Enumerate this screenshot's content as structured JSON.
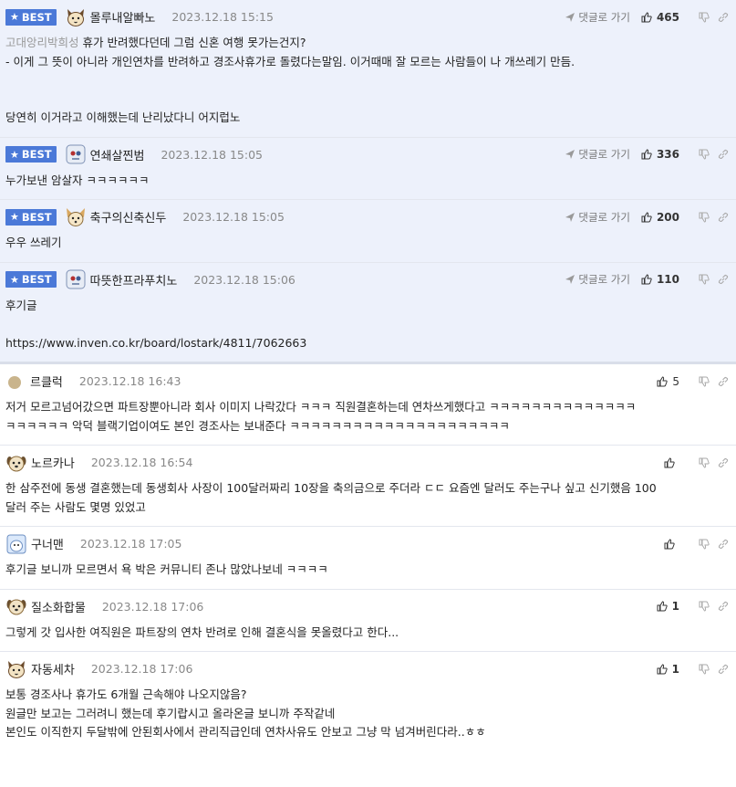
{
  "best_label": "BEST",
  "reply_label": "댓글로 가기",
  "best_comments": [
    {
      "nick": "몰루내알빠노",
      "avatar": "cat-face-icon",
      "date": "2023.12.18 15:15",
      "likes": "465",
      "target": "고대앙리박희성",
      "first_line": " 휴가 반려했다던데 그럼 신혼 여행 못가는건지?",
      "text": "- 이게 그 뜻이 아니라 개인연차를 반려하고 경조사휴가로 돌렸다는말임. 이거때매 잘 모르는 사람들이 나 개쓰레기 만듬.\n\n\n당연히 이거라고 이해했는데 난리났다니 어지럽노"
    },
    {
      "nick": "연쇄살찐범",
      "avatar": "robot-face-icon",
      "date": "2023.12.18 15:05",
      "likes": "336",
      "target": "",
      "first_line": "",
      "text": "누가보낸 암살자 ㅋㅋㅋㅋㅋㅋ"
    },
    {
      "nick": "축구의신축신두",
      "avatar": "fox-face-icon",
      "date": "2023.12.18 15:05",
      "likes": "200",
      "target": "",
      "first_line": "",
      "text": "우우 쓰레기"
    },
    {
      "nick": "따뜻한프라푸치노",
      "avatar": "robot-face-icon",
      "date": "2023.12.18 15:06",
      "likes": "110",
      "target": "",
      "first_line": "",
      "text": "후기글\n\nhttps://www.inven.co.kr/board/lostark/4811/7062663"
    }
  ],
  "comments": [
    {
      "nick": "르클럭",
      "avatar": "dot-avatar-icon",
      "date": "2023.12.18 16:43",
      "likes": "5",
      "text": "저거 모르고넘어갔으면 파트장뿐아니라 회사 이미지 나락갔다 ㅋㅋㅋ 직원결혼하는데 연차쓰게했다고 ㅋㅋㅋㅋㅋㅋㅋㅋㅋㅋㅋㅋㅋㅋ\nㅋㅋㅋㅋㅋㅋ 악덕 블랙기업이여도 본인 경조사는 보내준다 ㅋㅋㅋㅋㅋㅋㅋㅋㅋㅋㅋㅋㅋㅋㅋㅋㅋㅋㅋㅋㅋ"
    },
    {
      "nick": "노르카나",
      "avatar": "dog-face-icon",
      "date": "2023.12.18 16:54",
      "likes": "",
      "text": "한 삼주전에 동생 결혼했는데 동생회사 사장이 100달러짜리 10장을 축의금으로 주더라 ㄷㄷ 요즘엔 달러도 주는구나 싶고 신기했음 100\n달러 주는 사람도 몇명 있었고"
    },
    {
      "nick": "구너맨",
      "avatar": "bear-face-icon",
      "date": "2023.12.18 17:05",
      "likes": "",
      "text": "후기글 보니까 모르면서 욕 박은 커뮤니티 존나 많았나보네 ㅋㅋㅋㅋ"
    },
    {
      "nick": "질소화합물",
      "avatar": "dog-face-icon",
      "date": "2023.12.18 17:06",
      "likes": "1",
      "text": "그렇게 갓 입사한 여직원은 파트장의 연차 반려로 인해 결혼식을 못올렸다고 한다..."
    },
    {
      "nick": "자동세차",
      "avatar": "cat-face-icon",
      "date": "2023.12.18 17:06",
      "likes": "1",
      "text": "보통 경조사나 휴가도 6개월 근속해야 나오지않음?\n원글만 보고는 그러려니 했는데 후기랍시고 올라온글 보니까 주작같네\n본인도 이직한지 두달밖에 안된회사에서 관리직급인데 연차사유도 안보고 그냥 막 넘겨버린다라..ㅎㅎ"
    }
  ]
}
